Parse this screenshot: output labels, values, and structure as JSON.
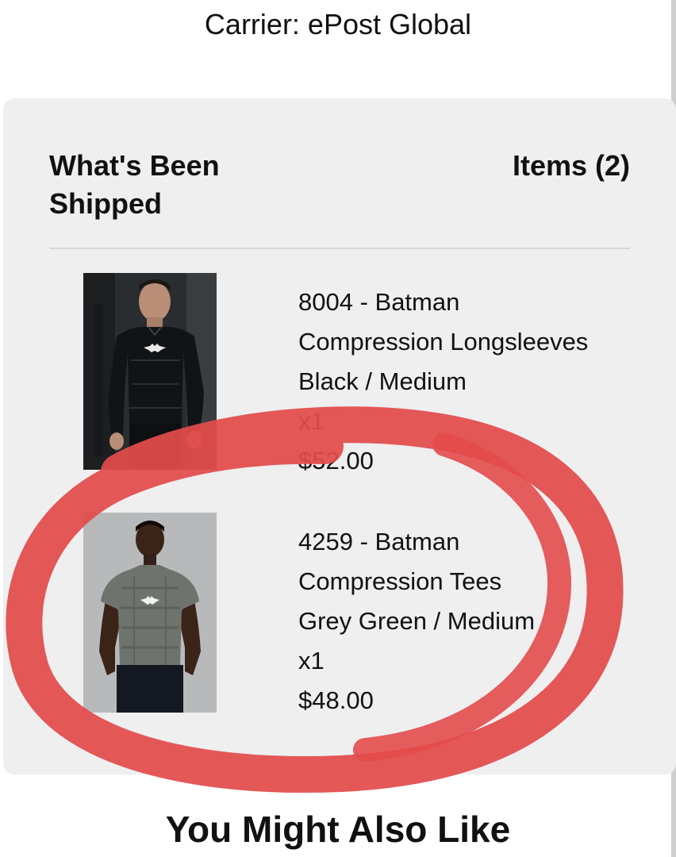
{
  "header": {
    "carrier": "Carrier: ePost Global"
  },
  "shipment": {
    "title": "What's Been Shipped",
    "items_count": "Items (2)",
    "items": [
      {
        "name_line1": "8004 - Batman",
        "name_line2": "Compression Longsleeves",
        "variant": "Black / Medium",
        "quantity": "x1",
        "price": "$52.00",
        "image": "man-in-black-longsleeve-compression-shirt"
      },
      {
        "name_line1": "4259 - Batman",
        "name_line2": "Compression Tees",
        "variant": "Grey Green / Medium",
        "quantity": "x1",
        "price": "$48.00",
        "image": "man-in-grey-compression-tee"
      }
    ]
  },
  "recommendations": {
    "title": "You Might Also Like"
  },
  "colors": {
    "card_background": "#efeff0",
    "annotation_red": "#e34b4b"
  }
}
